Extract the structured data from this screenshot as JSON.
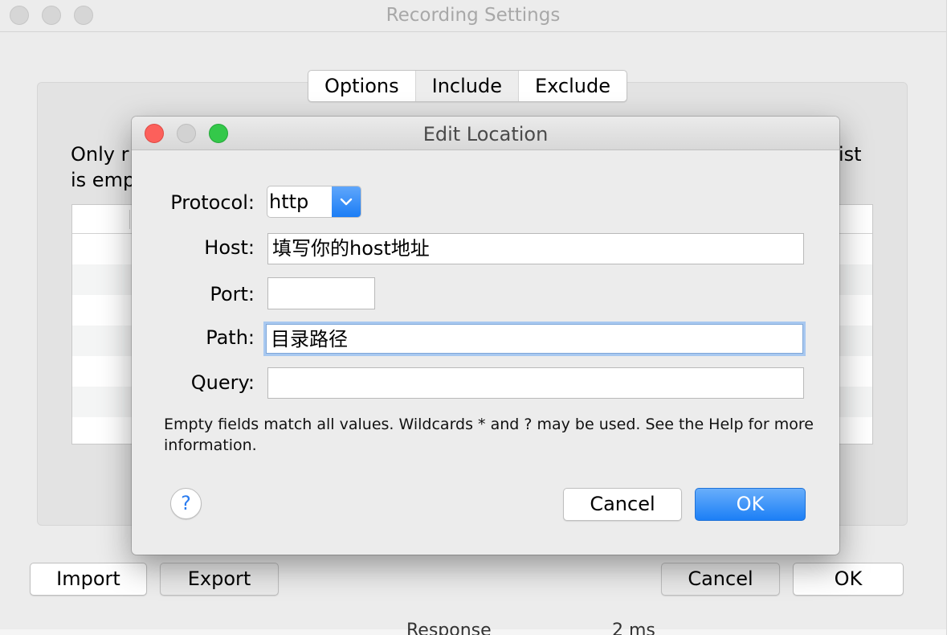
{
  "window": {
    "title": "Recording Settings"
  },
  "tabs": [
    {
      "label": "Options"
    },
    {
      "label": "Include"
    },
    {
      "label": "Exclude"
    }
  ],
  "panel": {
    "description_left": "Only r\nis emp",
    "description_right": "ist"
  },
  "footer": {
    "import_label": "Import",
    "export_label": "Export",
    "cancel_label": "Cancel",
    "ok_label": "OK",
    "partial_left": "Response",
    "partial_right": "2 ms"
  },
  "dialog": {
    "title": "Edit Location",
    "protocol_label": "Protocol:",
    "protocol_value": "http",
    "host_label": "Host:",
    "host_value": "填写你的host地址",
    "port_label": "Port:",
    "port_value": "",
    "path_label": "Path:",
    "path_value": "目录路径",
    "query_label": "Query:",
    "query_value": "",
    "note": "Empty fields match all values. Wildcards * and ? may be used. See the Help for more information.",
    "help_label": "?",
    "cancel_label": "Cancel",
    "ok_label": "OK"
  },
  "colors": {
    "accent": "#1b7df5",
    "close": "#fc605b",
    "minimize": "#d2d2d2",
    "zoom": "#34c84a"
  }
}
